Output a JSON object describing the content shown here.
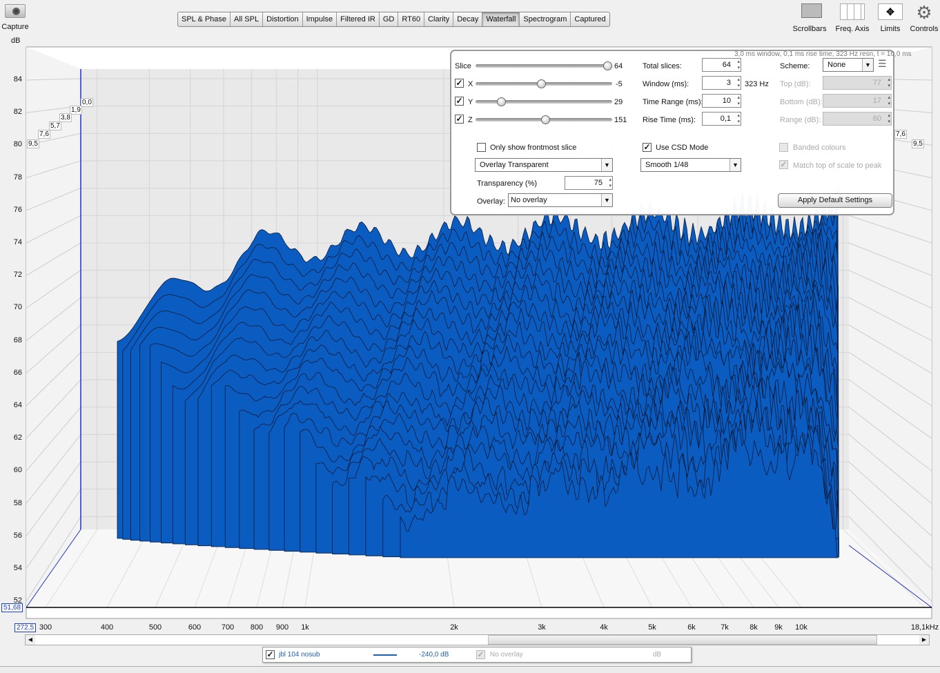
{
  "toolbar": {
    "capture": "Capture",
    "scrollbars": "Scrollbars",
    "freq_axis": "Freq. Axis",
    "limits": "Limits",
    "controls": "Controls"
  },
  "tabs": [
    {
      "label": "SPL & Phase"
    },
    {
      "label": "All SPL"
    },
    {
      "label": "Distortion"
    },
    {
      "label": "Impulse"
    },
    {
      "label": "Filtered IR"
    },
    {
      "label": "GD"
    },
    {
      "label": "RT60"
    },
    {
      "label": "Clarity"
    },
    {
      "label": "Decay"
    },
    {
      "label": "Waterfall",
      "selected": true
    },
    {
      "label": "Spectrogram"
    },
    {
      "label": "Captured"
    }
  ],
  "plot": {
    "y_unit": "dB",
    "y_ticks": [
      "84",
      "82",
      "80",
      "78",
      "76",
      "74",
      "72",
      "70",
      "68",
      "66",
      "64",
      "62",
      "60",
      "58",
      "56",
      "54",
      "52"
    ],
    "x_ticks": [
      "300",
      "400",
      "500",
      "600",
      "700",
      "800",
      "900",
      "1k",
      "2k",
      "3k",
      "4k",
      "5k",
      "6k",
      "7k",
      "8k",
      "9k",
      "10k",
      "18,1kHz"
    ],
    "time_ticks": [
      "0,0",
      "1,9",
      "3,8",
      "5,7",
      "7,6",
      "9,5"
    ],
    "cursor_y": "51,68",
    "cursor_x": "272,5",
    "info": "3,0 ms window, 0,1 ms rise time,  323 Hz resn, t = 10,0 ms",
    "fill_color": "#0a5cc0"
  },
  "panel": {
    "slice": {
      "label": "Slice",
      "value": "64",
      "level": 1.0
    },
    "x": {
      "label": "X",
      "value": "-5",
      "checked": true,
      "level": 0.47
    },
    "y": {
      "label": "Y",
      "value": "29",
      "checked": true,
      "level": 0.19
    },
    "z": {
      "label": "Z",
      "value": "151",
      "checked": true,
      "level": 0.5
    },
    "total_slices": {
      "label": "Total slices:",
      "value": "64"
    },
    "window": {
      "label": "Window (ms):",
      "value": "3",
      "resn": "323 Hz"
    },
    "time_range": {
      "label": "Time Range (ms):",
      "value": "10"
    },
    "rise_time": {
      "label": "Rise Time (ms):",
      "value": "0,1"
    },
    "scheme": {
      "label": "Scheme:",
      "value": "None"
    },
    "top": {
      "label": "Top (dB):",
      "value": "77"
    },
    "bottom": {
      "label": "Bottom (dB):",
      "value": "17"
    },
    "range": {
      "label": "Range (dB):",
      "value": "60"
    },
    "only_frontmost": {
      "label": "Only show frontmost slice",
      "checked": false
    },
    "use_csd": {
      "label": "Use CSD Mode",
      "checked": true
    },
    "banded": {
      "label": "Banded colours",
      "checked": false
    },
    "match_top": {
      "label": "Match top of scale to peak",
      "checked": true
    },
    "overlay_mode": "Overlay Transparent",
    "smoothing": "Smooth 1/48",
    "transparency": {
      "label": "Transparency (%)",
      "value": "75"
    },
    "overlay": {
      "label": "Overlay:",
      "value": "No overlay"
    },
    "apply_default": "Apply Default Settings"
  },
  "legend": {
    "name": "jbl 104 nosub",
    "value": "-240,0 dB",
    "overlay": "No overlay",
    "overlay_unit": "dB",
    "color": "#1a5fb4"
  }
}
